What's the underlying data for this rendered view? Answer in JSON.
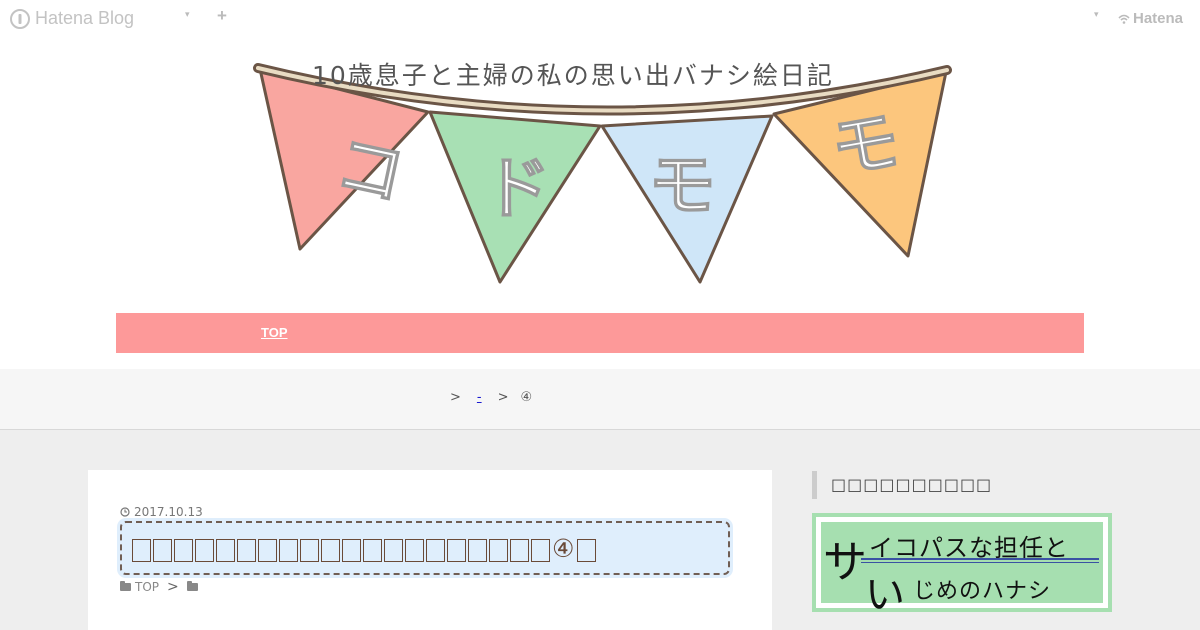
{
  "topbar": {
    "logo_text": "Hatena Blog",
    "add_symbol": "+",
    "caret": "▾",
    "brand_right": "Hatena"
  },
  "banner": {
    "subtitle": "10歳息子と主婦の私の思い出バナシ絵日記",
    "flags": [
      {
        "char": "コ",
        "color": "#f9a6a0"
      },
      {
        "char": "ド",
        "color": "#a8e0b4"
      },
      {
        "char": "モ",
        "color": "#cfe6f8"
      },
      {
        "char": "モ",
        "color": "#fcc67d"
      }
    ]
  },
  "nav": {
    "top_label": "TOP"
  },
  "breadcrumb": {
    "sep": ">",
    "link_text": "-",
    "current": "④"
  },
  "article": {
    "date": "2017.10.13",
    "title_number": "④",
    "category_top": "TOP",
    "category_sep": ">"
  },
  "sidebar": {
    "heading": "□□□□□□□□□□",
    "banner_lead_char": "サ",
    "banner_line1": "イコパスな担任と",
    "banner_second_char": "い",
    "banner_line2": "じめのハナシ"
  },
  "colors": {
    "nav": "#fd9999",
    "title_bg": "#dfeefc",
    "title_border": "#705e54",
    "sidebar_banner": "#a6dfb0"
  }
}
